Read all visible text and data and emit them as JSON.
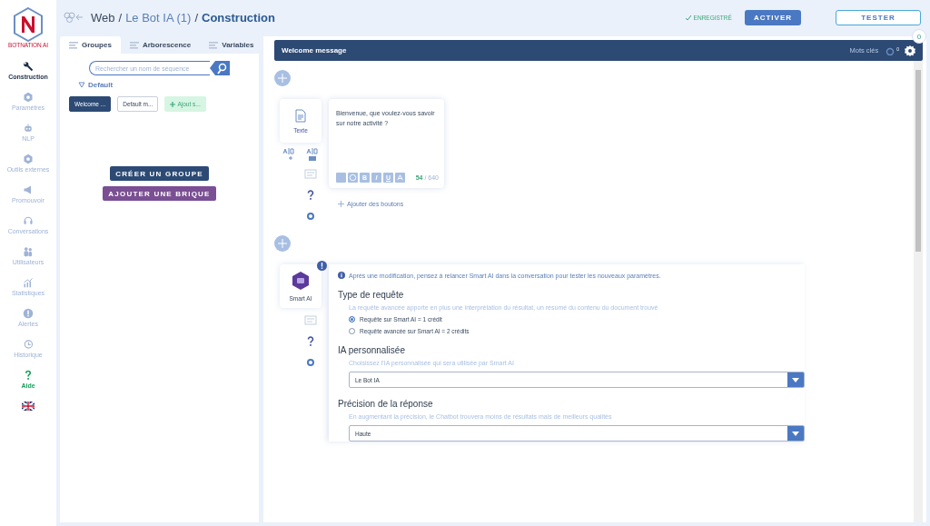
{
  "sidebar": {
    "logo_text": "BOTNATION AI",
    "items": [
      {
        "label": "Construction",
        "selected": true,
        "kind": "wrench"
      },
      {
        "label": "Paramètres",
        "selected": false,
        "kind": "gear"
      },
      {
        "label": "NLP",
        "selected": false,
        "kind": "robot"
      },
      {
        "label": "Outils externes",
        "selected": false,
        "kind": "gear"
      },
      {
        "label": "Promouvoir",
        "selected": false,
        "kind": "megaphone"
      },
      {
        "label": "Conversations",
        "selected": false,
        "kind": "headset"
      },
      {
        "label": "Utilisateurs",
        "selected": false,
        "kind": "users"
      },
      {
        "label": "Statistiques",
        "selected": false,
        "kind": "chart"
      },
      {
        "label": "Alertes",
        "selected": false,
        "kind": "alert"
      },
      {
        "label": "Historique",
        "selected": false,
        "kind": "history"
      },
      {
        "label": "Aide",
        "selected": false,
        "kind": "help"
      }
    ]
  },
  "breadcrumb": [
    {
      "label": "Web",
      "current": false
    },
    {
      "label": "Le Bot IA (1)",
      "current": false
    },
    {
      "label": "Construction",
      "current": true
    }
  ],
  "breadcrumb_separator": "/",
  "save_status": "ENREGISTRÉ",
  "buttons": [
    {
      "label": "ACTIVER",
      "kind": "filled"
    },
    {
      "label": "TESTER",
      "kind": "outline"
    }
  ],
  "notification_count": "0",
  "left_panel": {
    "tabs": [
      {
        "label": "Groupes",
        "selected": true
      },
      {
        "label": "Arborescence",
        "selected": false
      },
      {
        "label": "Variables",
        "selected": false
      }
    ],
    "search": {
      "placeholder": "Rechercher un nom de séquence"
    },
    "folder": {
      "label": "Default",
      "expanded": true
    },
    "chips": [
      {
        "label": "Welcome ...",
        "kind": "group",
        "selected": true
      },
      {
        "label": "Default m...",
        "kind": "group",
        "selected": false
      },
      {
        "label": "Ajout s...",
        "kind": "add",
        "selected": false
      }
    ],
    "actions": [
      {
        "label": "CRÉER UN GROUPE",
        "color": "#2c4a74"
      },
      {
        "label": "AJOUTER UNE BRIQUE",
        "color": "#7a4f93"
      }
    ]
  },
  "sequence": {
    "title": "Welcome message",
    "keywords_label": "Mots clés",
    "keywords_count": "0",
    "text_block": {
      "label": "Texte",
      "message": "Bienvenue, que voulez-vous savoir sur notre activité ?",
      "format_buttons": [
        "B",
        "I",
        "U"
      ],
      "count": "54",
      "count_separator": "/",
      "max": "640",
      "add_buttons": "Ajouter des boutons"
    },
    "smart_block": {
      "label": "Smart AI",
      "info": "Après une modification, pensez à relancer Smart AI dans la conversation pour tester les nouveaux paramètres.",
      "sections": [
        {
          "title": "Type de requête",
          "description": "La requête avancée apporte en plus une interprétation du résultat, un résumé du contenu du document trouvé",
          "kind": "radio",
          "options": [
            {
              "label": "Requête sur Smart AI = 1 crédit",
              "selected": true
            },
            {
              "label": "Requête avancée sur Smart AI = 2 crédits",
              "selected": false
            }
          ]
        },
        {
          "title": "IA personnalisée",
          "description": "Choisissez l'IA personnalisée qui sera utilisée par Smart AI",
          "kind": "select",
          "value": "Le Bot IA"
        },
        {
          "title": "Précision de la réponse",
          "description": "En augmentant la précision, le Chatbot trouvera moins de résultats mais de meilleurs qualités",
          "kind": "select",
          "value": "Haute"
        }
      ]
    }
  }
}
